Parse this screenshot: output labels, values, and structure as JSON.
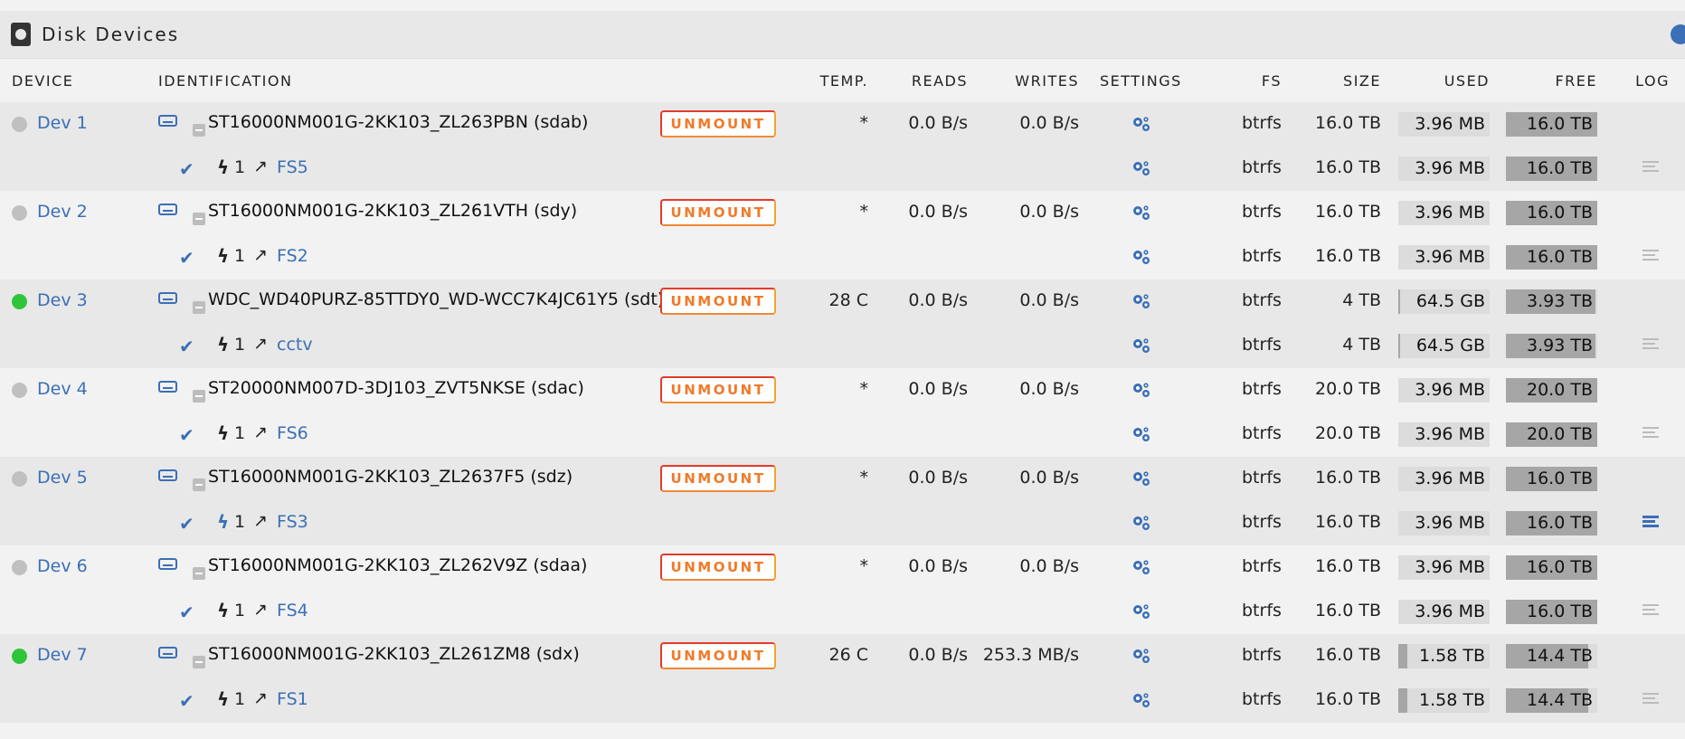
{
  "panel": {
    "title": "Disk Devices"
  },
  "columns": {
    "device": "DEVICE",
    "identification": "IDENTIFICATION",
    "temp": "TEMP.",
    "reads": "READS",
    "writes": "WRITES",
    "settings": "SETTINGS",
    "fs": "FS",
    "size": "SIZE",
    "used": "USED",
    "free": "FREE",
    "log": "LOG"
  },
  "devices": [
    {
      "name": "Dev 1",
      "status": "idle",
      "identification": "ST16000NM001G-2KK103_ZL263PBN (sdab)",
      "action": "UNMOUNT",
      "temp": "*",
      "reads": "0.0 B/s",
      "writes": "0.0 B/s",
      "fs": "btrfs",
      "size": "16.0 TB",
      "used": "3.96 MB",
      "free": "16.0 TB",
      "used_fraction": 0.0,
      "slot": "1",
      "share": "FS5",
      "log_active": false
    },
    {
      "name": "Dev 2",
      "status": "idle",
      "identification": "ST16000NM001G-2KK103_ZL261VTH (sdy)",
      "action": "UNMOUNT",
      "temp": "*",
      "reads": "0.0 B/s",
      "writes": "0.0 B/s",
      "fs": "btrfs",
      "size": "16.0 TB",
      "used": "3.96 MB",
      "free": "16.0 TB",
      "used_fraction": 0.0,
      "slot": "1",
      "share": "FS2",
      "log_active": false
    },
    {
      "name": "Dev 3",
      "status": "active",
      "identification": "WDC_WD40PURZ-85TTDY0_WD-WCC7K4JC61Y5 (sdt)",
      "action": "UNMOUNT",
      "temp": "28 C",
      "reads": "0.0 B/s",
      "writes": "0.0 B/s",
      "fs": "btrfs",
      "size": "4 TB",
      "used": "64.5 GB",
      "free": "3.93 TB",
      "used_fraction": 0.016,
      "slot": "1",
      "share": "cctv",
      "log_active": false
    },
    {
      "name": "Dev 4",
      "status": "idle",
      "identification": "ST20000NM007D-3DJ103_ZVT5NKSE (sdac)",
      "action": "UNMOUNT",
      "temp": "*",
      "reads": "0.0 B/s",
      "writes": "0.0 B/s",
      "fs": "btrfs",
      "size": "20.0 TB",
      "used": "3.96 MB",
      "free": "20.0 TB",
      "used_fraction": 0.0,
      "slot": "1",
      "share": "FS6",
      "log_active": false
    },
    {
      "name": "Dev 5",
      "status": "idle",
      "identification": "ST16000NM001G-2KK103_ZL2637F5 (sdz)",
      "action": "UNMOUNT",
      "temp": "*",
      "reads": "0.0 B/s",
      "writes": "0.0 B/s",
      "fs": "btrfs",
      "size": "16.0 TB",
      "used": "3.96 MB",
      "free": "16.0 TB",
      "used_fraction": 0.0,
      "slot": "1",
      "share": "FS3",
      "log_active": true
    },
    {
      "name": "Dev 6",
      "status": "idle",
      "identification": "ST16000NM001G-2KK103_ZL262V9Z (sdaa)",
      "action": "UNMOUNT",
      "temp": "*",
      "reads": "0.0 B/s",
      "writes": "0.0 B/s",
      "fs": "btrfs",
      "size": "16.0 TB",
      "used": "3.96 MB",
      "free": "16.0 TB",
      "used_fraction": 0.0,
      "slot": "1",
      "share": "FS4",
      "log_active": false
    },
    {
      "name": "Dev 7",
      "status": "active",
      "identification": "ST16000NM001G-2KK103_ZL261ZM8 (sdx)",
      "action": "UNMOUNT",
      "temp": "26 C",
      "reads": "0.0 B/s",
      "writes": "253.3 MB/s",
      "fs": "btrfs",
      "size": "16.0 TB",
      "used": "1.58 TB",
      "free": "14.4 TB",
      "used_fraction": 0.099,
      "slot": "1",
      "share": "FS1",
      "log_active": false
    }
  ],
  "colors": {
    "accent": "#3b6fb6",
    "status_active": "#2fc53a",
    "status_idle": "#c0c0c0",
    "unmount_text": "#f07a28",
    "unmount_border": "#e43b2a"
  }
}
